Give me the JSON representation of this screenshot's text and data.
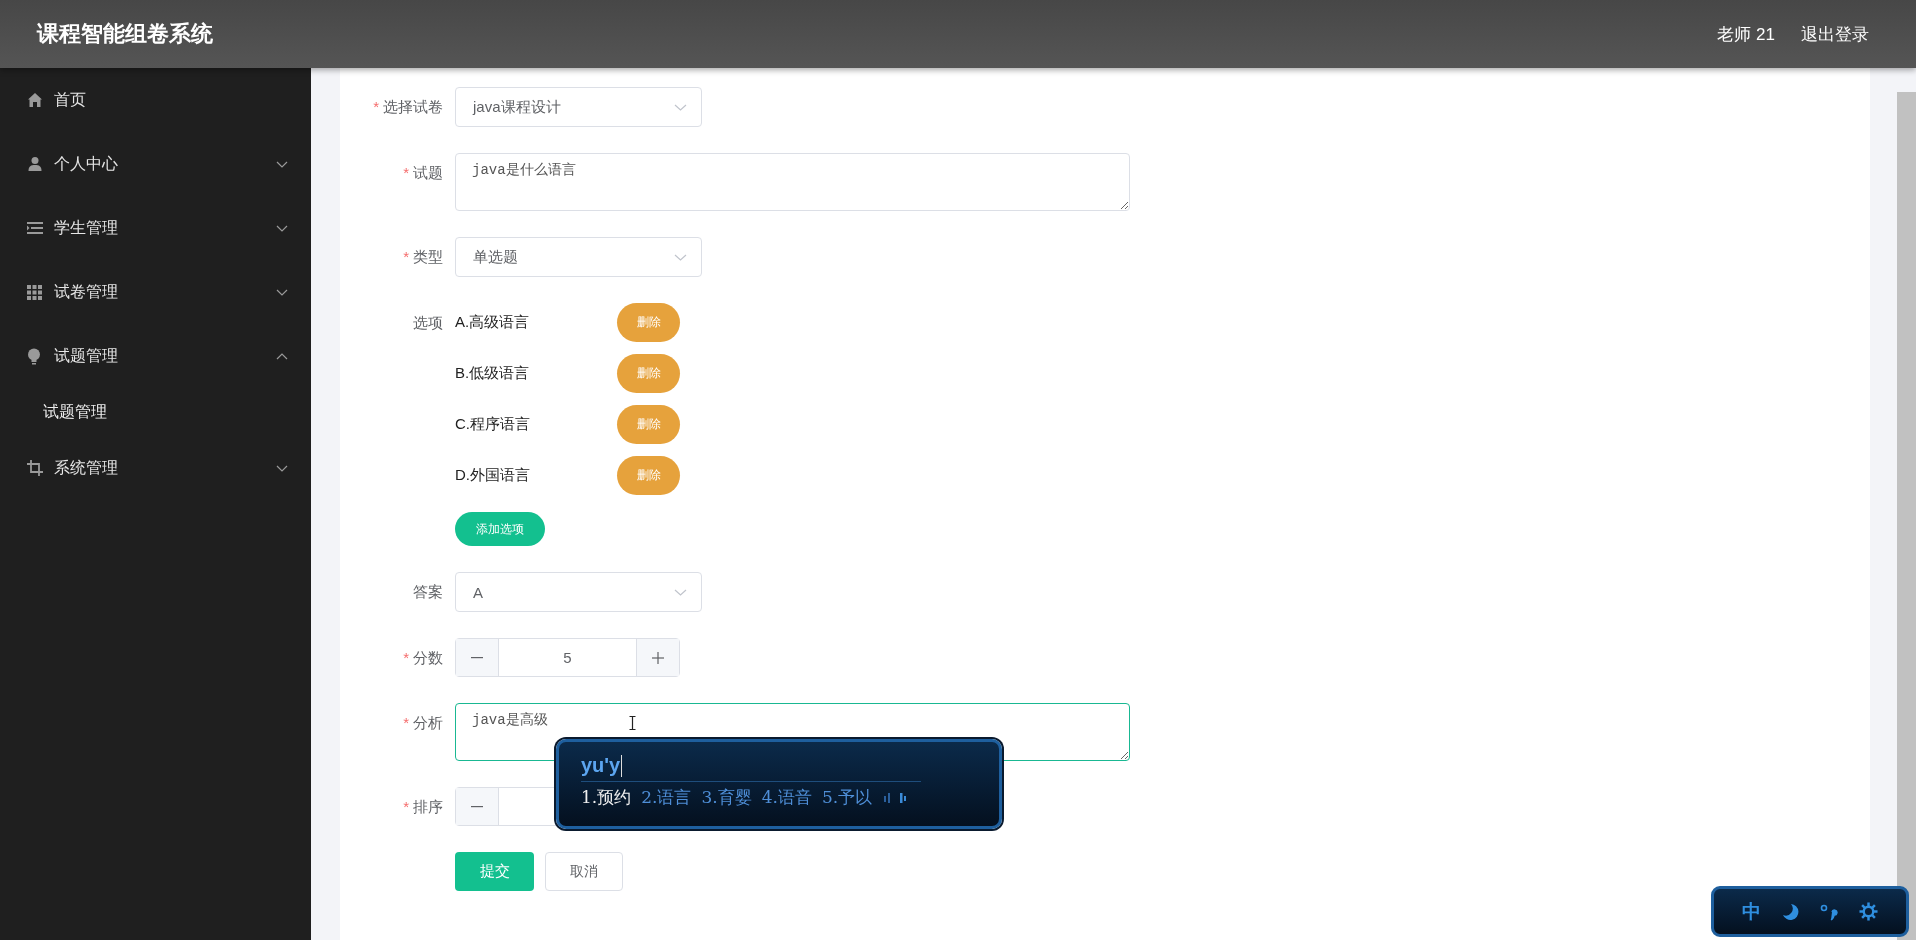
{
  "header": {
    "title": "课程智能组卷系统",
    "user": "老师 21",
    "logout": "退出登录"
  },
  "sidebar": {
    "items": [
      {
        "label": "首页"
      },
      {
        "label": "个人中心",
        "expanded": false
      },
      {
        "label": "学生管理",
        "expanded": false
      },
      {
        "label": "试卷管理",
        "expanded": false
      },
      {
        "label": "试题管理",
        "expanded": true,
        "children": [
          {
            "label": "试题管理"
          }
        ]
      },
      {
        "label": "系统管理",
        "expanded": false
      }
    ]
  },
  "form": [
    {
      "kind": "select",
      "marker": "*",
      "label": "选择试卷",
      "value": "java课程设计"
    },
    {
      "kind": "textarea",
      "marker": "*",
      "label": "试题",
      "value": "java是什么语言",
      "focused": false
    },
    {
      "kind": "select",
      "marker": "*",
      "label": "类型",
      "value": "单选题"
    },
    {
      "kind": "options",
      "label": "选项",
      "options": [
        {
          "text": "A.高级语言",
          "delete": "删除"
        },
        {
          "text": "B.低级语言",
          "delete": "删除"
        },
        {
          "text": "C.程序语言",
          "delete": "删除"
        },
        {
          "text": "D.外国语言",
          "delete": "删除"
        }
      ],
      "add": "添加选项"
    },
    {
      "kind": "select",
      "label": "答案",
      "value": "A"
    },
    {
      "kind": "stepper",
      "marker": "*",
      "label": "分数",
      "value": "5"
    },
    {
      "kind": "textarea",
      "marker": "*",
      "label": "分析",
      "value": "java是高级",
      "focused": true
    },
    {
      "kind": "stepper",
      "marker": "*",
      "label": "排序"
    },
    {
      "kind": "actions",
      "buttons": [
        {
          "label": "提交",
          "primary": true
        },
        {
          "label": "取消",
          "primary": false
        }
      ]
    }
  ],
  "ime": {
    "composition": "yu'y",
    "candidates": [
      {
        "label": "1.预约",
        "selected": true
      },
      {
        "label": "2.语言",
        "selected": false
      },
      {
        "label": "3.育婴",
        "selected": false
      },
      {
        "label": "4.语音",
        "selected": false
      },
      {
        "label": "5.予以",
        "selected": false
      }
    ]
  },
  "ime_toolbar": {
    "mode": "中"
  }
}
